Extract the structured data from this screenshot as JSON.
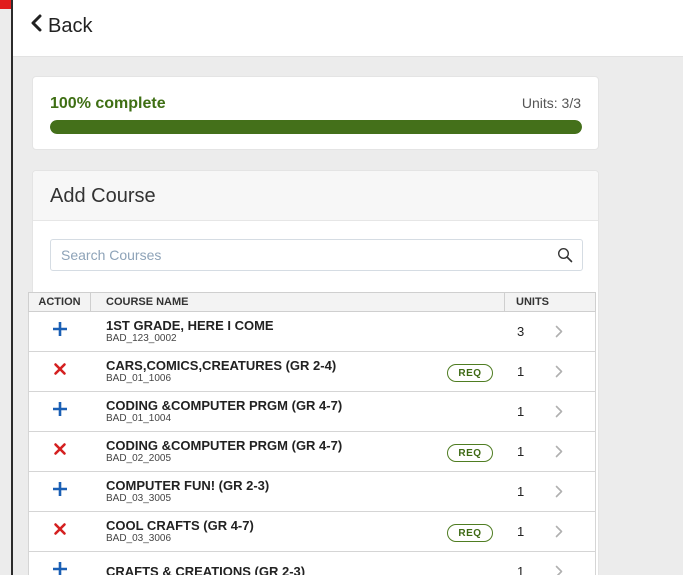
{
  "nav": {
    "back_label": "Back"
  },
  "progress": {
    "label": "100% complete",
    "units_label": "Units: 3/3",
    "percent": 100,
    "bar_color": "#44701a"
  },
  "add_course": {
    "title": "Add Course",
    "search_placeholder": "Search Courses",
    "columns": {
      "action": "ACTION",
      "course_name": "COURSE NAME",
      "units": "UNITS"
    },
    "courses": [
      {
        "action": "add",
        "name": "1ST GRADE, HERE I COME",
        "code": "BAD_123_0002",
        "req": false,
        "units": "3"
      },
      {
        "action": "remove",
        "name": "CARS,COMICS,CREATURES (GR 2-4)",
        "code": "BAD_01_1006",
        "req": true,
        "req_label": "REQ",
        "units": "1"
      },
      {
        "action": "add",
        "name": "CODING &COMPUTER PRGM (GR 4-7)",
        "code": "BAD_01_1004",
        "req": false,
        "units": "1"
      },
      {
        "action": "remove",
        "name": "CODING &COMPUTER PRGM (GR 4-7)",
        "code": "BAD_02_2005",
        "req": true,
        "req_label": "REQ",
        "units": "1"
      },
      {
        "action": "add",
        "name": "COMPUTER FUN! (GR 2-3)",
        "code": "BAD_03_3005",
        "req": false,
        "units": "1"
      },
      {
        "action": "remove",
        "name": "COOL CRAFTS (GR 4-7)",
        "code": "BAD_03_3006",
        "req": true,
        "req_label": "REQ",
        "units": "1"
      },
      {
        "action": "add",
        "name": "CRAFTS & CREATIONS (GR 2-3)",
        "code": "",
        "req": false,
        "units": "1"
      }
    ]
  },
  "colors": {
    "add_icon": "#1a5fb4",
    "remove_icon": "#d42020",
    "accent_green": "#3f6f14"
  },
  "icons": {
    "back": "chevron-left-icon",
    "search": "search-icon",
    "add": "plus-icon",
    "remove": "x-icon",
    "row": "chevron-right-icon"
  }
}
